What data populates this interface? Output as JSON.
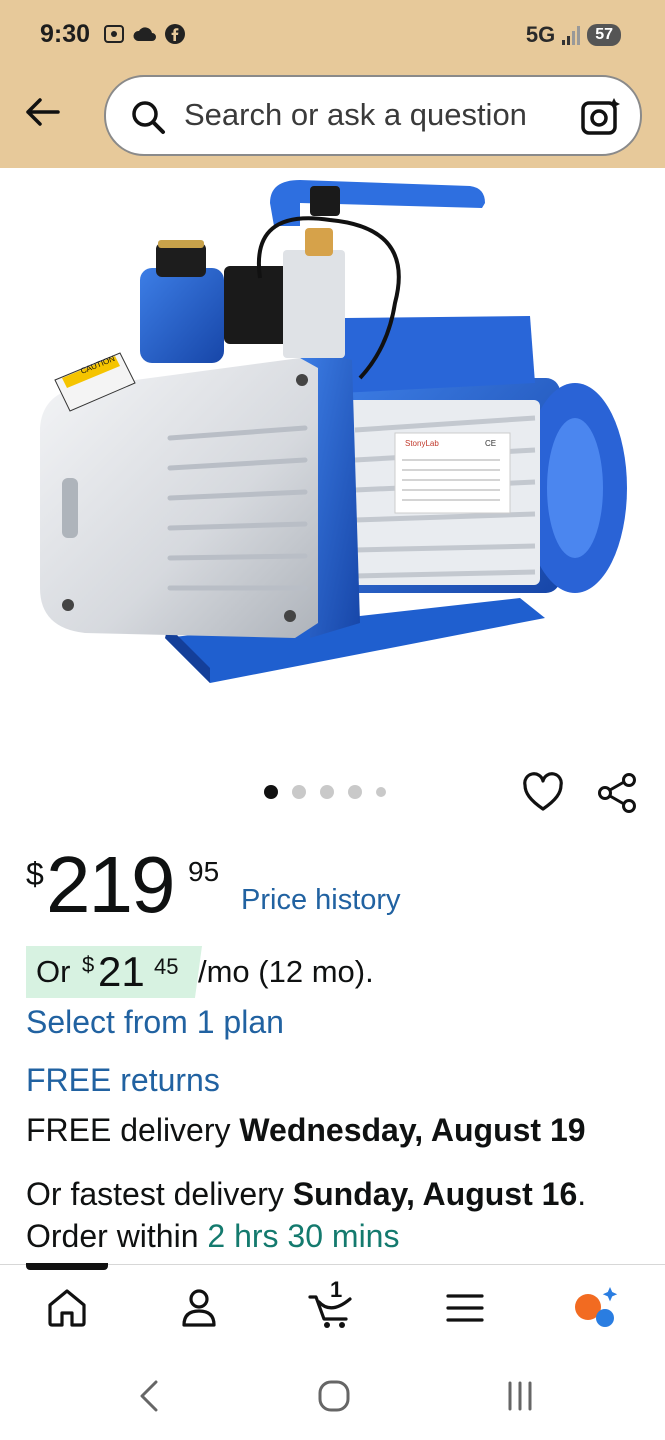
{
  "status_bar": {
    "time": "9:30",
    "network": "5G",
    "battery": "57",
    "icons": [
      "screenshot-icon",
      "cloud-icon",
      "facebook-icon",
      "signal-icon"
    ]
  },
  "search": {
    "placeholder": "Search or ask a question",
    "icons": [
      "back-arrow-icon",
      "search-icon",
      "camera-lens-icon"
    ]
  },
  "product": {
    "image_alt": "StonyLab 2 Stage Vacuum Pump",
    "image_labels": {
      "brand": "StonyLab",
      "caution": "CAUTION",
      "cert": "CE"
    },
    "carousel_count": 5,
    "carousel_active": 1
  },
  "price": {
    "symbol": "$",
    "whole": "219",
    "fraction": "95",
    "history_label": "Price history"
  },
  "installment": {
    "prefix": "Or",
    "symbol": "$",
    "whole": "21",
    "fraction": "45",
    "suffix": "/mo (12 mo).",
    "plan_link": "Select from 1 plan"
  },
  "delivery": {
    "returns": "FREE returns",
    "free_prefix": "FREE delivery ",
    "free_date": "Wednesday, August 19",
    "fast_prefix": "Or fastest delivery ",
    "fast_date": "Sunday, August 16",
    "fast_period": ".",
    "order_prefix": "Order within ",
    "order_time": "2 hrs 30 mins"
  },
  "bottom_nav": {
    "cart_count": "1",
    "items": [
      "home-icon",
      "account-icon",
      "cart-icon",
      "menu-icon",
      "rufus-ai-icon"
    ]
  },
  "colors": {
    "header_bg": "#e7c99a",
    "link": "#2162a1",
    "installment_bg": "#d7f2e1",
    "green_text": "#147a6e",
    "pump_blue": "#1f5fcf"
  }
}
